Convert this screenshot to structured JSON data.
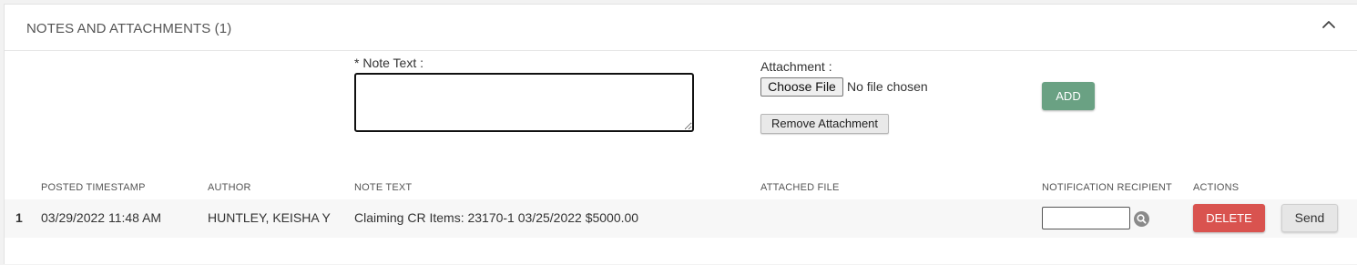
{
  "panel": {
    "title": "NOTES AND ATTACHMENTS (1)",
    "collapse_icon": "chevron-up-icon"
  },
  "form": {
    "note_label": "* Note Text :",
    "note_value": "",
    "attachment_label": "Attachment :",
    "choose_file_label": "Choose File",
    "file_status": "No file chosen",
    "remove_attachment_label": "Remove Attachment",
    "add_label": "ADD"
  },
  "table": {
    "columns": [
      "POSTED TIMESTAMP",
      "AUTHOR",
      "NOTE TEXT",
      "ATTACHED FILE",
      "NOTIFICATION RECIPIENT",
      "ACTIONS"
    ],
    "rows": [
      {
        "index": "1",
        "timestamp": "03/29/2022 11:48 AM",
        "author": "HUNTLEY, KEISHA Y",
        "note_text": "Claiming CR Items: 23170-1 03/25/2022 $5000.00",
        "attached_file": "",
        "recipient_value": "",
        "search_icon": "search-icon",
        "delete_label": "DELETE",
        "send_label": "Send"
      }
    ]
  },
  "colors": {
    "add_button": "#6aa183",
    "delete_button": "#d9534f",
    "send_button": "#e6e6e6"
  }
}
